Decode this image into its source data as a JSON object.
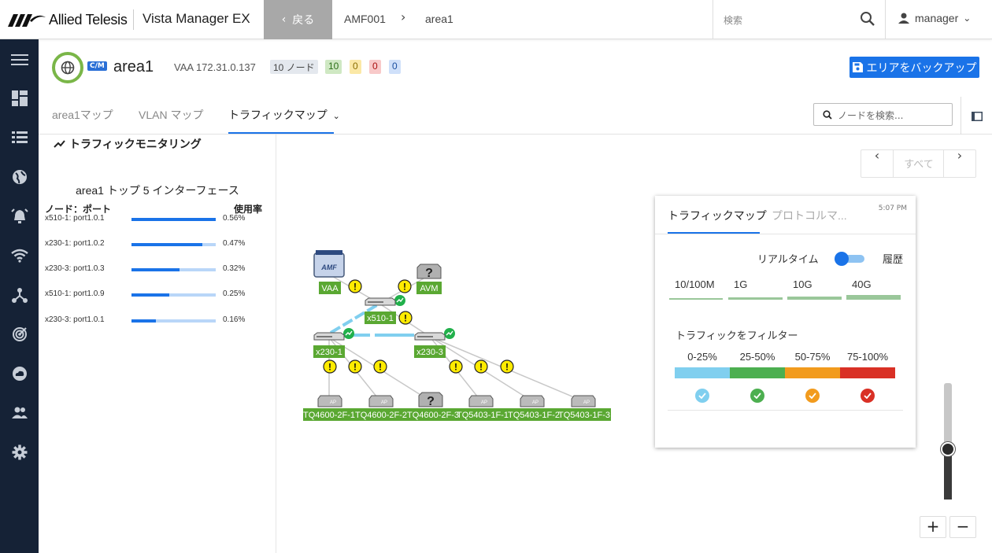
{
  "topbar": {
    "brand": "Allied Telesis",
    "app_name": "Vista Manager EX",
    "back_label": "戻る",
    "breadcrumb": [
      "AMF001",
      "area1"
    ],
    "search_placeholder": "検索",
    "user_name": "manager"
  },
  "sidebar": {
    "icons": [
      "menu-icon",
      "dashboard-icon",
      "list-icon",
      "globe-icon",
      "alarm-icon",
      "wifi-icon",
      "topology-icon",
      "signal-icon",
      "cloud-icon",
      "users-icon",
      "settings-icon"
    ]
  },
  "area": {
    "title": "area1",
    "cm_label": "C/M",
    "vaa_label": "VAA 172.31.0.137",
    "node_count": "10 ノード",
    "status_green": "10",
    "status_yellow": "0",
    "status_red": "0",
    "status_blue": "0",
    "backup_label": "エリアをバックアップ"
  },
  "tabs": [
    {
      "label": "area1マップ"
    },
    {
      "label": "VLAN マップ"
    },
    {
      "label": "トラフィックマップ"
    }
  ],
  "node_search_placeholder": "ノードを検索...",
  "left_panel": {
    "title": "トラフィックモニタリング",
    "subtitle": "area1 トップ 5 インターフェース",
    "col_node": "ノード：ポート",
    "col_usage": "使用率",
    "rows": [
      {
        "label": "x510-1: port1.0.1",
        "usage": "0.56%",
        "fraction": 1.0
      },
      {
        "label": "x230-1: port1.0.2",
        "usage": "0.47%",
        "fraction": 0.84
      },
      {
        "label": "x230-3: port1.0.3",
        "usage": "0.32%",
        "fraction": 0.57
      },
      {
        "label": "x510-1: port1.0.9",
        "usage": "0.25%",
        "fraction": 0.45
      },
      {
        "label": "x230-3: port1.0.1",
        "usage": "0.16%",
        "fraction": 0.29
      }
    ]
  },
  "map_nav": {
    "all_label": "すべて"
  },
  "legend": {
    "tab_traffic": "トラフィックマップ",
    "tab_protocol": "プロトコルマ...",
    "time": "5:07 PM",
    "realtime_label": "リアルタイム",
    "history_label": "履歴",
    "speeds": [
      "10/100M",
      "1G",
      "10G",
      "40G"
    ],
    "filter_title": "トラフィックをフィルター",
    "filters": [
      {
        "label": "0-25%",
        "color": "#80cfef"
      },
      {
        "label": "25-50%",
        "color": "#4caf50"
      },
      {
        "label": "50-75%",
        "color": "#f29b1d"
      },
      {
        "label": "75-100%",
        "color": "#d93025"
      }
    ]
  },
  "topology": {
    "nodes": [
      "VAA",
      "AVM",
      "x510-1",
      "x230-1",
      "x230-3",
      "TQ4600-2F-1",
      "TQ4600-2F-2",
      "TQ4600-2F-3",
      "TQ5403-1F-1",
      "TQ5403-1F-2",
      "TQ5403-1F-3"
    ],
    "device_labels": {
      "amf": "AMF",
      "unknown": "?",
      "ap": "AP"
    }
  },
  "zoom": {
    "plus": "+",
    "minus": "−",
    "level": 0.43
  },
  "colors": {
    "accent": "#1a73e8",
    "sidebar": "#152236",
    "node_green": "#5aa832"
  }
}
